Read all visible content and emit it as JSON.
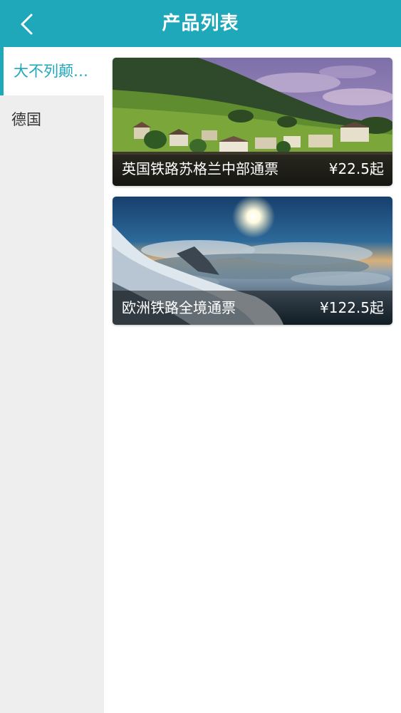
{
  "header": {
    "title": "产品列表",
    "back_icon": "chevron-left-icon",
    "background": "#1ea8b9"
  },
  "sidebar": {
    "items": [
      {
        "label": "大不列颠…",
        "active": true
      },
      {
        "label": "德国",
        "active": false
      }
    ],
    "accent": "#1ea8b9"
  },
  "products": [
    {
      "name": "英国铁路苏格兰中部通票",
      "price": "¥22.5起",
      "image": "village-lake-hillside-photo"
    },
    {
      "name": "欧洲铁路全境通票",
      "price": "¥122.5起",
      "image": "sun-over-clouds-mountain-photo"
    }
  ]
}
